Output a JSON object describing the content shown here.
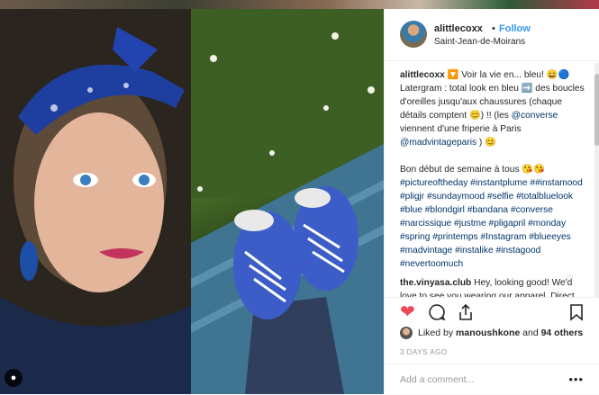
{
  "post": {
    "username": "alittlecoxx",
    "separator": "•",
    "follow_label": "Follow",
    "location": "Saint-Jean-de-Moirans"
  },
  "caption": {
    "author": "alittlecoxx",
    "line1": " 🔽 Voir la vie en... bleu! 😄🔵",
    "line2": "Latergram : total look en bleu ➡️ des boucles d'oreilles jusqu'aux chaussures (chaque détails comptent 😊) !! (les ",
    "mention1": "@converse",
    "line3": " viennent d'une friperie à Paris ",
    "mention2": "@madvintageparis",
    "line4": " ) 😊",
    "line5": "Bon début de semaine à tous 😘😘",
    "hashtags": "#pictureoftheday #instantplume ##instamood #pligjr #sundaymood #selfie #totalbluelook #blue #blondgirl #bandana #converse #narcissique #justme #pligapril #monday #spring #printemps #Instagram #blueeyes #madvintage #instalike #instagood #nevertoomuch"
  },
  "comment": {
    "author": "the.vinyasa.club",
    "text": " Hey, looking good! We'd love to see you wearing our apparel. Direct message us when you"
  },
  "likes": {
    "prefix": "Liked by ",
    "user": "manoushkone",
    "and": " and ",
    "count": "94 others"
  },
  "time_ago": "3 DAYS AGO",
  "add_comment_placeholder": "Add a comment...",
  "more_label": "•••",
  "colors": {
    "like_red": "#ed4956",
    "link_blue": "#3897f0"
  },
  "icons": [
    "heart-icon",
    "comment-icon",
    "share-icon",
    "bookmark-icon",
    "user-tag-icon"
  ]
}
